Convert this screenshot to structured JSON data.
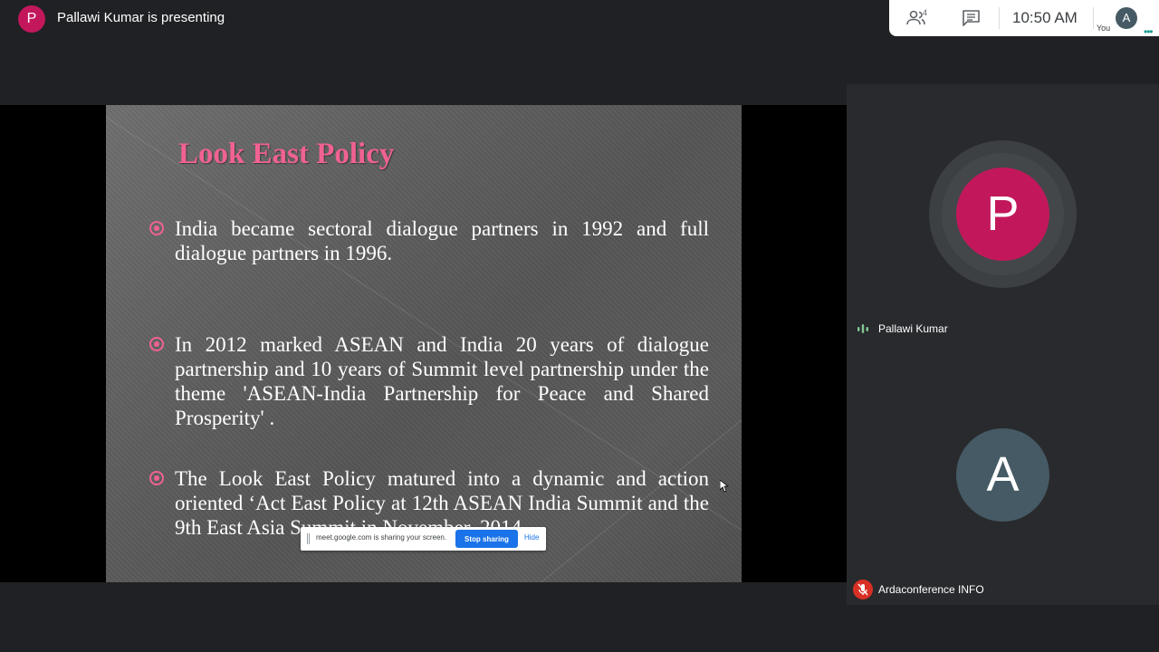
{
  "header": {
    "presenter_initial": "P",
    "presenting_text": "Pallawi Kumar is presenting",
    "people_count": "4",
    "time": "10:50 AM",
    "self_initial": "A",
    "self_label": "You"
  },
  "slide": {
    "title": "Look East Policy",
    "bullets": [
      "India became sectoral dialogue partners in 1992 and full dialogue partners in 1996.",
      "In 2012 marked ASEAN and India 20 years of dialogue partnership and 10 years of Summit level partnership under the theme 'ASEAN-India Partnership for Peace and Shared Prosperity' .",
      "The Look East Policy matured into a dynamic and action oriented ‘Act East Policy at 12th ASEAN India Summit and the 9th East Asia Summit in November, 2014."
    ]
  },
  "share_banner": {
    "text": "meet.google.com is sharing your screen.",
    "stop_label": "Stop sharing",
    "hide_label": "Hide"
  },
  "participants": [
    {
      "initial": "P",
      "name": "Pallawi Kumar",
      "color": "#c2185b"
    },
    {
      "initial": "A",
      "name": "Ardaconference INFO",
      "color": "#455a64"
    }
  ],
  "colors": {
    "accent_pink": "#f06292",
    "stop_button": "#1a73e8",
    "mic_off": "#d93025"
  },
  "icons": [
    "people-icon",
    "chat-icon",
    "more-icon",
    "speaking-icon",
    "mic-off-icon",
    "cursor-icon"
  ]
}
